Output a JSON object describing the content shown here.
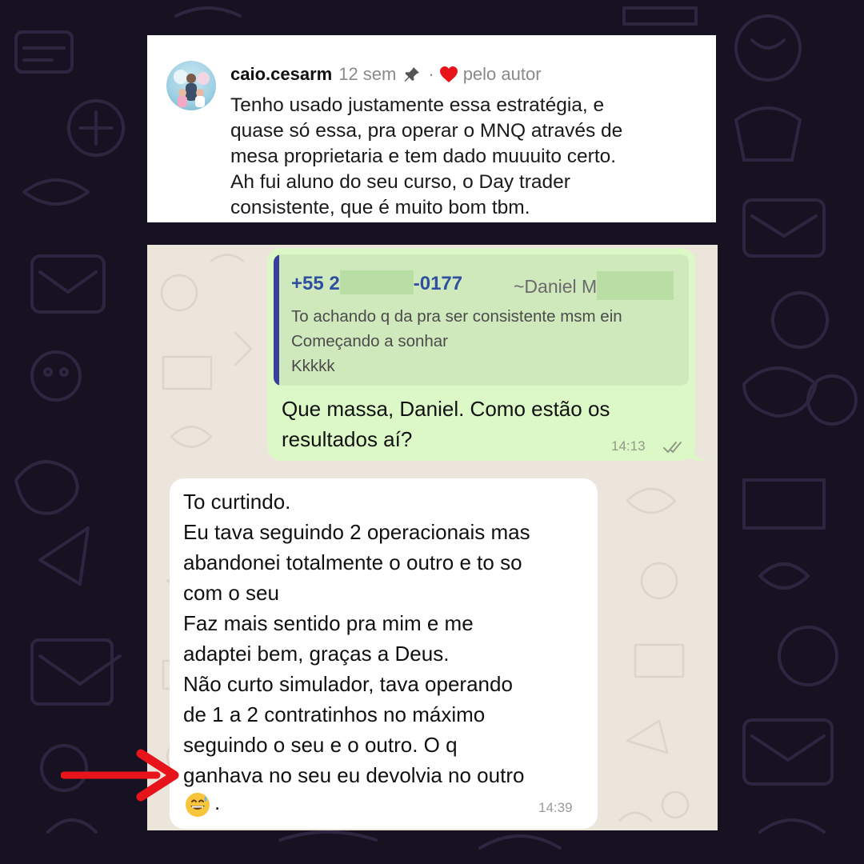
{
  "comment": {
    "username": "caio.cesarm",
    "time_ago": "12 sem",
    "separator": "·",
    "liked_by": "pelo autor",
    "text": "Tenho usado justamente essa estratégia, e\nquase só essa, pra operar o MNQ através de\nmesa proprietaria e tem dado muuuito certo.\nAh fui aluno do seu curso, o Day trader\nconsistente, que é muito bom tbm."
  },
  "chat": {
    "outgoing": {
      "quote": {
        "phone_start": "+55 2",
        "phone_end": "-0177",
        "sender": "~Daniel M",
        "text": "To achando q da pra ser consistente msm ein\nComeçando a sonhar\nKkkkk"
      },
      "text": "Que massa, Daniel. Como estão os\nresultados aí?",
      "time": "14:13"
    },
    "incoming": {
      "text": "To curtindo.\nEu tava seguindo 2 operacionais mas\nabandonei totalmente o outro e to so\ncom o seu\nFaz mais sentido pra mim e me\nadaptei bem, graças a Deus.\nNão curto simulador, tava operando\nde 1 a 2 contratinhos no máximo\nseguindo o seu e o outro. O q\nganhava no seu eu devolvia no outro",
      "tail": ".",
      "emoji": "grinning-sweat-emoji",
      "time": "14:39"
    }
  },
  "colors": {
    "background": "#161222",
    "chat_background": "#ebe5dc",
    "outgoing_bubble": "#dcf8c6",
    "incoming_bubble": "#ffffff",
    "quote_accent": "#3b3f9c",
    "arrow": "#e8141b",
    "heart": "#e8141b"
  }
}
